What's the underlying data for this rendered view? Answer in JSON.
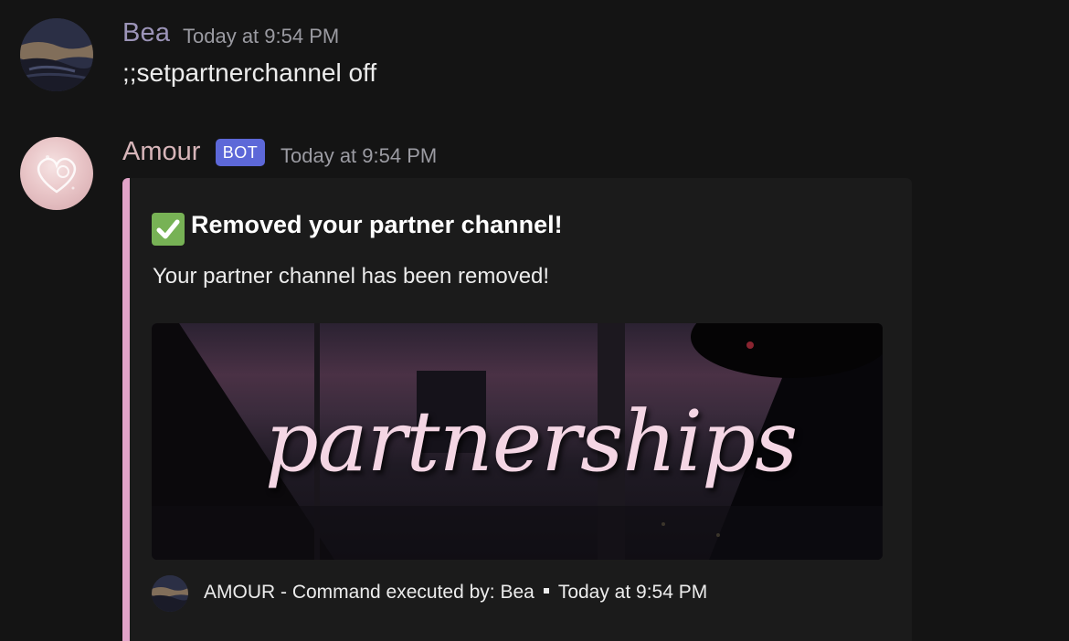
{
  "messages": [
    {
      "author": "Bea",
      "timestamp": "Today at 9:54 PM",
      "content": ";;setpartnerchannel off",
      "author_color": "#9c94b8",
      "avatar": "night-sky-avatar"
    },
    {
      "author": "Amour",
      "badge": "BOT",
      "timestamp": "Today at 9:54 PM",
      "author_color": "#d7b5b9",
      "avatar": "pink-heart-avatar",
      "embed": {
        "accent_color": "#e1a3c8",
        "title_icon": "check-mark-icon",
        "title": "Removed your partner channel!",
        "description": "Your partner channel has been removed!",
        "image_text": "partnerships",
        "footer": {
          "text": "AMOUR - Command executed by: Bea",
          "timestamp": "Today at 9:54 PM",
          "icon": "footer-avatar"
        }
      }
    }
  ]
}
